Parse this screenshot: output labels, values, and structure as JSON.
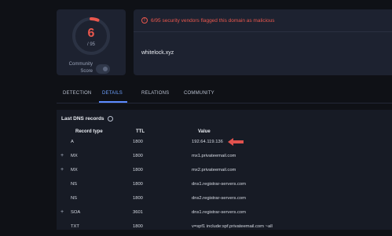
{
  "score": {
    "detections": "6",
    "total": "/ 95",
    "community_label_line1": "Community",
    "community_label_line2": "Score",
    "gauge_fraction": 0.063,
    "accent": "#e9574d"
  },
  "alert": {
    "text": "6/95 security vendors flagged this domain as malicious",
    "icon": "warning-icon"
  },
  "domain": "whitelock.xyz",
  "tabs": [
    {
      "label": "DETECTION",
      "active": false
    },
    {
      "label": "DETAILS",
      "active": true
    },
    {
      "label": "RELATIONS",
      "active": false
    },
    {
      "label": "COMMUNITY",
      "active": false
    }
  ],
  "dns": {
    "title": "Last DNS records",
    "headers": {
      "type": "Record type",
      "ttl": "TTL",
      "value": "Value"
    },
    "records": [
      {
        "expand": "",
        "type": "A",
        "ttl": "1800",
        "value": "192.64.119.136"
      },
      {
        "expand": "+",
        "type": "MX",
        "ttl": "1800",
        "value": "mx1.privateemail.com"
      },
      {
        "expand": "+",
        "type": "MX",
        "ttl": "1800",
        "value": "mx2.privateemail.com"
      },
      {
        "expand": "",
        "type": "NS",
        "ttl": "1800",
        "value": "dns1.registrar-servers.com"
      },
      {
        "expand": "",
        "type": "NS",
        "ttl": "1800",
        "value": "dns2.registrar-servers.com"
      },
      {
        "expand": "+",
        "type": "SOA",
        "ttl": "3601",
        "value": "dns1.registrar-servers.com"
      },
      {
        "expand": "",
        "type": "TXT",
        "ttl": "1800",
        "value": "v=spf1 include:spf.privateemail.com ~all"
      }
    ]
  }
}
